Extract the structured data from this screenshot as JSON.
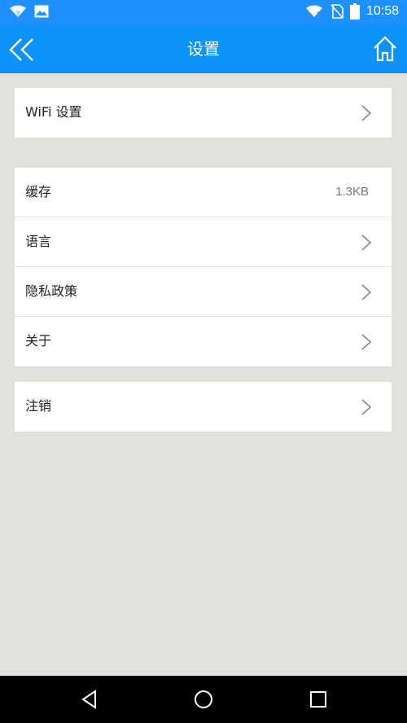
{
  "status_bar": {
    "time": "10:58",
    "icons": [
      "wifi-question-icon",
      "image-icon",
      "wifi-x-icon",
      "no-sim-icon",
      "battery-icon"
    ]
  },
  "app_bar": {
    "title": "设置",
    "back_icon": "double-chevron-left-icon",
    "home_icon": "home-icon"
  },
  "groups": [
    {
      "items": [
        {
          "label": "WiFi 设置"
        }
      ]
    },
    {
      "items": [
        {
          "label": "缓存",
          "value": "1.3KB"
        },
        {
          "label": "语言"
        },
        {
          "label": "隐私政策"
        },
        {
          "label": "关于"
        }
      ]
    },
    {
      "items": [
        {
          "label": "注销"
        }
      ]
    }
  ],
  "nav_bar": {
    "icons": [
      "back-triangle-icon",
      "home-circle-icon",
      "recents-square-icon"
    ]
  },
  "colors": {
    "primary": "#0c92fb",
    "background": "#e3e1dc"
  }
}
